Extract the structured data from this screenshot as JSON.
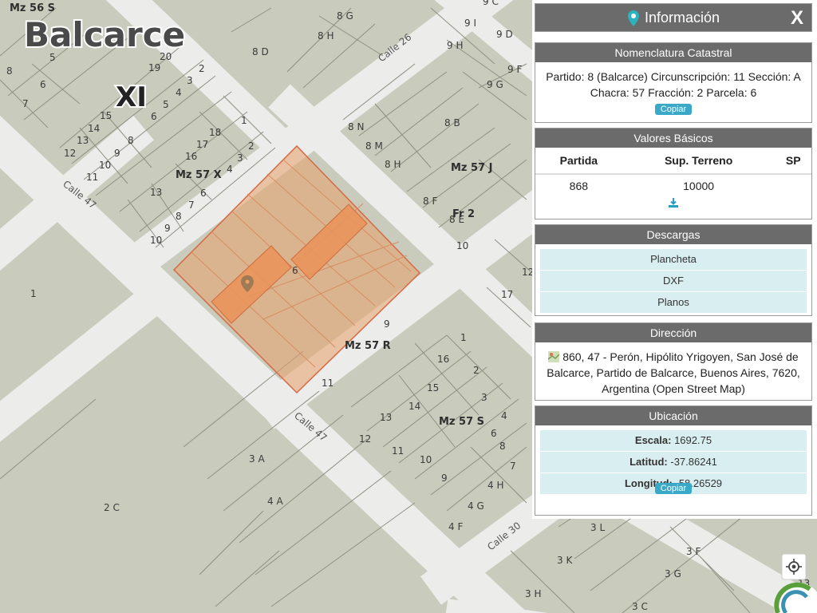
{
  "map": {
    "city_label": "Balcarce",
    "sector_label": "XI",
    "streets": {
      "calle_26": "Calle 26",
      "calle_47_a": "Calle 47",
      "calle_47_b": "Calle 47",
      "calle_30": "Calle 30"
    },
    "blocks": {
      "mz56s": "Mz 56 S",
      "mz57x": "Mz 57 X",
      "mz57j": "Mz 57 J",
      "mz57r": "Mz 57 R",
      "mz57s": "Mz 57 S",
      "fr2": "Fr 2"
    },
    "parcels": {
      "p8d": "8 D",
      "p8g": "8 G",
      "p8h": "8 H",
      "p9i": "9 I",
      "p9d": "9 D",
      "p9h": "9 H",
      "p9f": "9 F",
      "p9g": "9 G",
      "p9c": "9 C",
      "p8n": "8 N",
      "p8m": "8 M",
      "p8h2": "8 H",
      "p8b": "8 B",
      "p8f": "8 F",
      "p8e": "8 E",
      "p10a": "10",
      "p12": "12",
      "p17": "17",
      "p1a": "1",
      "p2c": "2 C",
      "p3a": "3 A",
      "p4a": "4 A",
      "p3l": "3 L",
      "p3f": "3 F",
      "p3k": "3 K",
      "p3g": "3 G",
      "p3h": "3 H",
      "p3c": "3 C",
      "p13": "13",
      "p4h": "4 H",
      "p4g": "4 G",
      "p4f": "4 F",
      "n5": "5",
      "n6": "6",
      "n7": "7",
      "n8": "8",
      "n20": "20",
      "n19": "19",
      "n2": "2",
      "n3": "3",
      "n4": "4",
      "n5b": "5",
      "n6b": "6",
      "n15": "15",
      "n14": "14",
      "n13": "13",
      "n12": "12",
      "n11": "11",
      "n10": "10",
      "n9": "9",
      "n8b": "8",
      "n1b": "1",
      "n18": "18",
      "n17": "17",
      "n16": "16",
      "n2b": "2",
      "n3b": "3",
      "n4b": "4",
      "n13b": "13",
      "n6c": "6",
      "n7b": "7",
      "n8c": "8",
      "n9b": "9",
      "n10b": "10",
      "n6d": "6",
      "n9c": "9",
      "n11b": "11",
      "n1c": "1",
      "n16b": "16",
      "n2c": "2",
      "n15b": "15",
      "n3c": "3",
      "n4c": "4",
      "n14b": "14",
      "n13c": "13",
      "n12b": "12",
      "n11c": "11",
      "n10c": "10",
      "n9d": "9",
      "n8d": "8",
      "n7c": "7",
      "n6e": "6"
    }
  },
  "panel": {
    "title": "Información",
    "close_label": "X",
    "nomenclatura": {
      "header": "Nomenclatura Catastral",
      "text": "Partido: 8 (Balcarce) Circunscripción: 11 Sección: A Chacra: 57 Fracción: 2 Parcela: 6",
      "copy_label": "Copiar"
    },
    "valores": {
      "header": "Valores Básicos",
      "columns": [
        "Partida",
        "Sup. Terreno",
        "SP"
      ],
      "row": [
        "868",
        "10000",
        ""
      ]
    },
    "descargas": {
      "header": "Descargas",
      "items": [
        "Plancheta",
        "DXF",
        "Planos"
      ]
    },
    "direccion": {
      "header": "Dirección",
      "text": "860, 47 - Perón, Hipólito Yrigoyen, San José de Balcarce, Partido de Balcarce, Buenos Aires, 7620, Argentina (Open Street Map)"
    },
    "ubicacion": {
      "header": "Ubicación",
      "escala_label": "Escala:",
      "escala_value": "1692.75",
      "latitud_label": "Latitud:",
      "latitud_value": "-37.86241",
      "longitud_label": "Longitud:",
      "longitud_value": "-58.26529",
      "copy_label": "Copiar"
    }
  },
  "colors": {
    "map_bg": "#c9cbbd",
    "street": "#ececea",
    "parcel_highlight": "#e8a06a",
    "header_bg": "#6b6b6b",
    "accent": "#3aa9c7",
    "row_bg": "#d9eef0"
  }
}
